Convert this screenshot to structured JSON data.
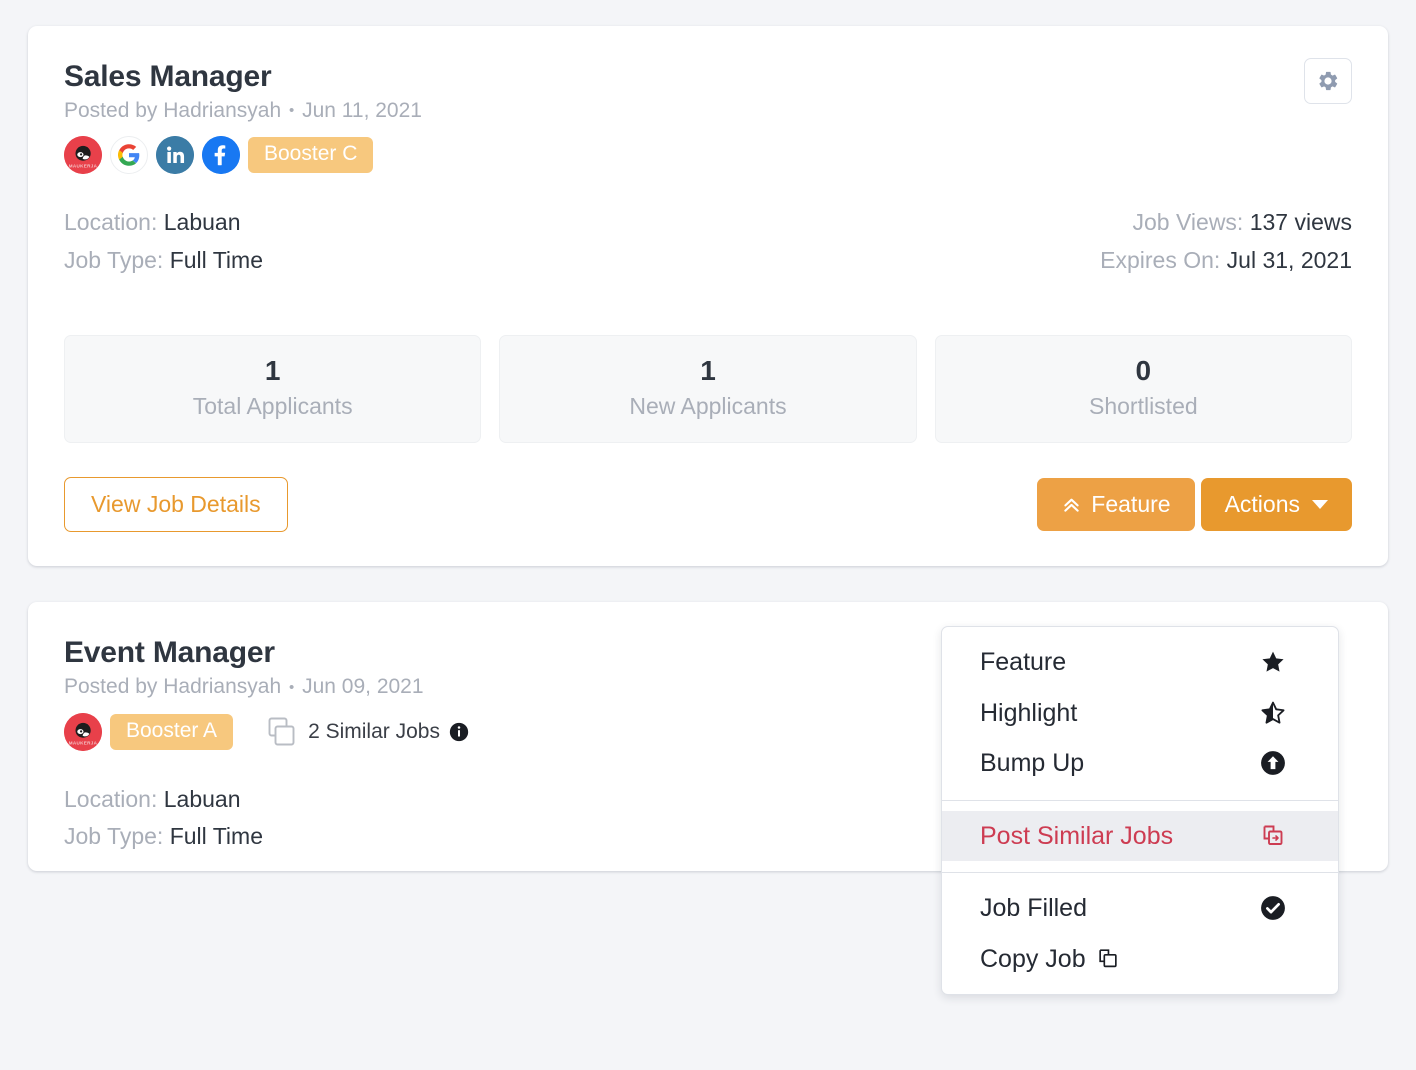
{
  "jobs": [
    {
      "title": "Sales Manager",
      "posted_by": "Posted by Hadriansyah",
      "separator": "•",
      "posted_date": "Jun 11, 2021",
      "booster": "Booster C",
      "social_icons": [
        "maukerja-icon",
        "google-icon",
        "linkedin-icon",
        "facebook-icon"
      ],
      "meta": {
        "location_key": "Location:",
        "location_value": "Labuan",
        "jobtype_key": "Job Type:",
        "jobtype_value": "Full Time",
        "views_key": "Job Views:",
        "views_value": "137 views",
        "expires_key": "Expires On:",
        "expires_value": "Jul 31, 2021"
      },
      "stats": [
        {
          "value": "1",
          "label": "Total Applicants"
        },
        {
          "value": "1",
          "label": "New Applicants"
        },
        {
          "value": "0",
          "label": "Shortlisted"
        }
      ],
      "buttons": {
        "view_details": "View Job Details",
        "feature": "Feature",
        "actions": "Actions"
      }
    },
    {
      "title": "Event Manager",
      "posted_by": "Posted by Hadriansyah",
      "separator": "•",
      "posted_date": "Jun 09, 2021",
      "booster": "Booster A",
      "similar_jobs": "2 Similar Jobs",
      "social_icons": [
        "maukerja-icon"
      ],
      "meta": {
        "location_key": "Location:",
        "location_value": "Labuan",
        "jobtype_key": "Job Type:",
        "jobtype_value": "Full Time"
      }
    }
  ],
  "dropdown": {
    "items": [
      {
        "label": "Feature",
        "icon": "star-filled-icon"
      },
      {
        "label": "Highlight",
        "icon": "star-half-icon"
      },
      {
        "label": "Bump Up",
        "icon": "arrow-up-circle-icon"
      },
      {
        "label": "Post Similar Jobs",
        "icon": "copy-arrow-icon"
      },
      {
        "label": "Job Filled",
        "icon": "check-circle-icon"
      },
      {
        "label": "Copy Job",
        "icon": "copy-icon"
      }
    ],
    "active_item": "Post Similar Jobs"
  },
  "colors": {
    "page_background": "#f4f5f8",
    "card_background": "#ffffff",
    "accent_orange": "#e8992e",
    "feature_orange": "#eda145",
    "booster_badge": "#f7c87e",
    "muted_text": "#a9aeb8",
    "dark_text": "#2f3640",
    "active_red": "#cd3c52",
    "hover_background": "#ecedf1"
  },
  "icons": {
    "gear": "gear-icon",
    "feature_chevrons": "double-chevron-up-icon",
    "actions_caret": "caret-down-icon",
    "similar_jobs_copy": "copy-icon",
    "similar_jobs_info": "info-circle-icon"
  }
}
